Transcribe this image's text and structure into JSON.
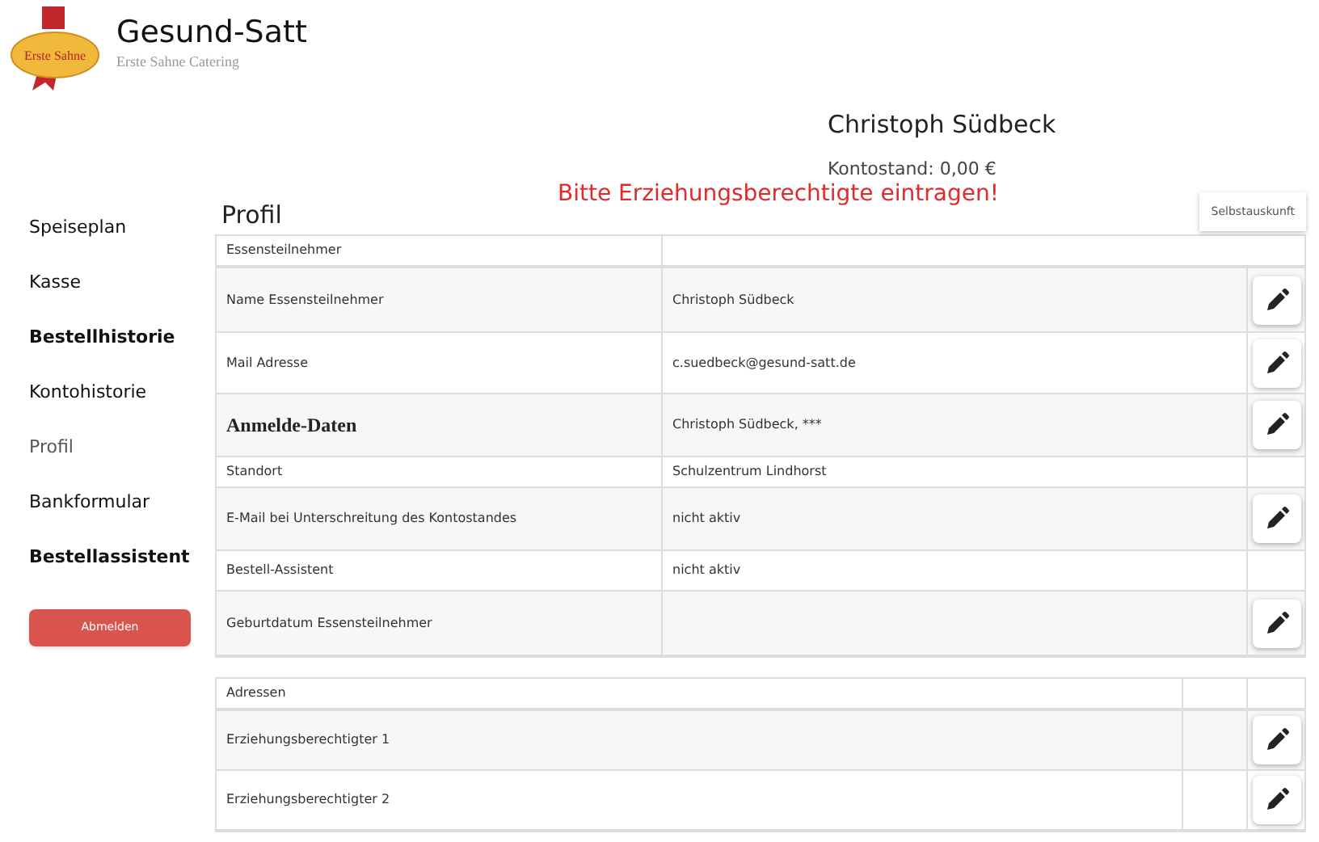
{
  "brand": {
    "logo_text": "Erste Sahne",
    "title": "Gesund-Satt",
    "subtitle": "Erste Sahne Catering"
  },
  "user": {
    "name": "Christoph Südbeck",
    "balance": "Kontostand: 0,00 €"
  },
  "warning": "Bitte Erziehungsberechtigte eintragen!",
  "sidebar": {
    "items": [
      {
        "label": "Speiseplan",
        "selected": false
      },
      {
        "label": "Kasse",
        "selected": false
      },
      {
        "label": "Bestellhistorie",
        "selected": false
      },
      {
        "label": "Kontohistorie",
        "selected": false
      },
      {
        "label": "Profil",
        "selected": true
      },
      {
        "label": "Bankformular",
        "selected": false
      },
      {
        "label": "Bestellassistent",
        "selected": false
      }
    ],
    "logout": "Abmelden"
  },
  "page_title": "Profil",
  "self_report_button": "Selbstauskunft",
  "profile_table": {
    "header": "Essensteilnehmer",
    "rows": [
      {
        "label": "Name Essensteilnehmer",
        "value": "Christoph Südbeck",
        "kind": "plain",
        "editable": true
      },
      {
        "label": "Mail Adresse",
        "value": "c.suedbeck@gesund-satt.de",
        "kind": "plain",
        "editable": true
      },
      {
        "label": "Anmelde-Daten",
        "value": "Christoph Südbeck, ***",
        "kind": "heading",
        "editable": true
      },
      {
        "label": "Standort",
        "value": "Schulzentrum Lindhorst",
        "kind": "plain",
        "editable": false
      },
      {
        "label": "E-Mail bei Unterschreitung des Kontostandes",
        "value": "nicht aktiv",
        "kind": "plain",
        "editable": true
      },
      {
        "label": "Bestell-Assistent",
        "value": "nicht aktiv",
        "kind": "plain",
        "editable": false
      },
      {
        "label": "Geburtdatum Essensteilnehmer",
        "kind": "plain",
        "editable": true
      }
    ]
  },
  "address_table": {
    "header": "Adressen",
    "rows": [
      {
        "label": "Erziehungsberechtigter 1",
        "editable": true
      },
      {
        "label": "Erziehungsberechtigter 2",
        "editable": true
      }
    ]
  }
}
